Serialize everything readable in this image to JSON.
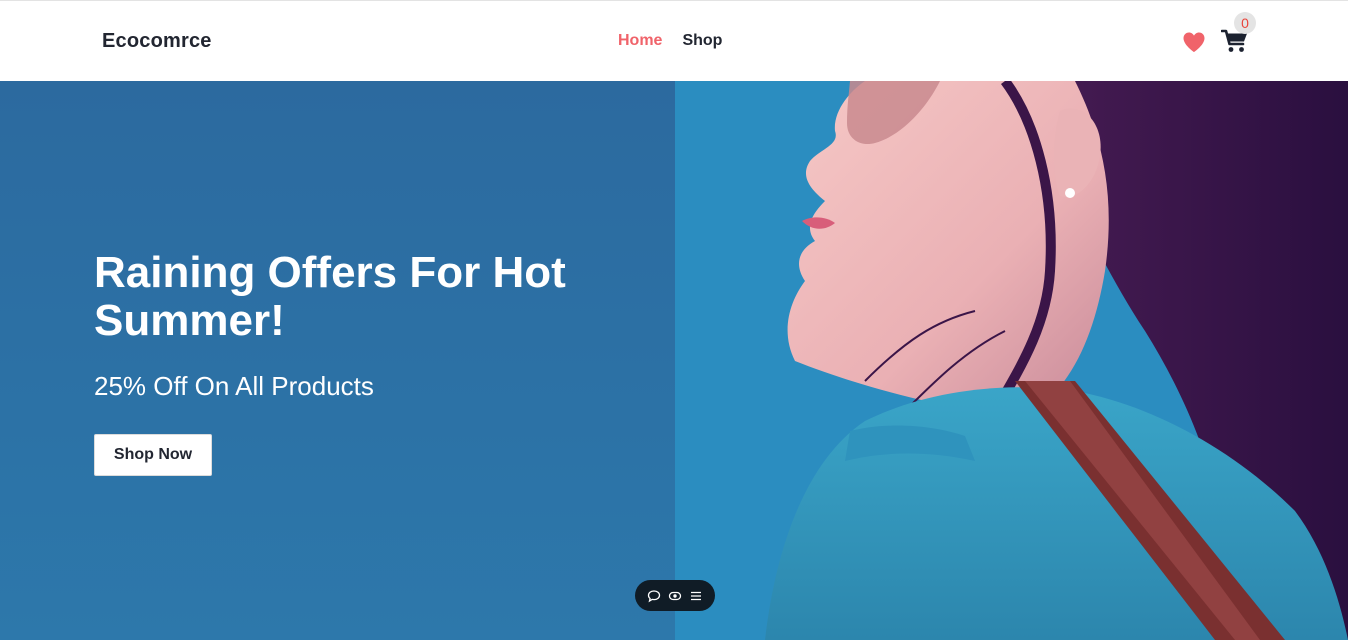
{
  "header": {
    "brand": "Ecocomrce",
    "nav": [
      {
        "label": "Home",
        "active": true
      },
      {
        "label": "Shop",
        "active": false
      }
    ],
    "icons": {
      "wishlist": "heart-icon",
      "cart": "shopping-cart-icon"
    },
    "cart_count": "0"
  },
  "hero": {
    "title": "Raining Offers For Hot Summer!",
    "subtitle": "25% Off On All Products",
    "cta_label": "Shop Now",
    "image": "woman-in-sunglasses-photo"
  },
  "toolbar": {
    "icons": [
      "comment-icon",
      "eye-icon",
      "menu-icon"
    ]
  },
  "colors": {
    "accent": "#f0636a",
    "text_dark": "#222631",
    "hero_left_bg": "#2c6f a3",
    "hero_right_bg": "#2b8dc0",
    "badge_text": "#e9453c"
  }
}
